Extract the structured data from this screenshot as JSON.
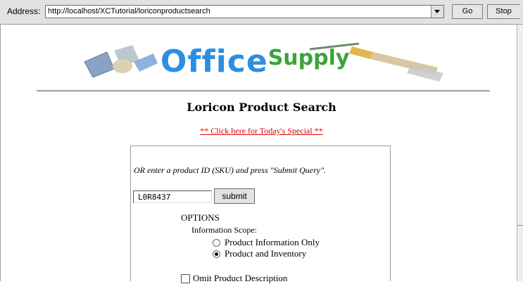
{
  "browser": {
    "address_label": "Address:",
    "url": "http://localhost/XCTutorial/loriconproductsearch",
    "go_label": "Go",
    "stop_label": "Stop"
  },
  "logo": {
    "office": "Office",
    "supply": "Supply"
  },
  "page": {
    "title": "Loricon Product Search",
    "special_link": "** Click here for Today's Special **"
  },
  "search": {
    "instructions": "OR enter a product ID (SKU) and press \"Submit Query\".",
    "sku_value": "L0R8437",
    "submit_label": "submit"
  },
  "options": {
    "heading": "OPTIONS",
    "scope_label": "Information Scope:",
    "radios": [
      {
        "label": "Product Information Only",
        "selected": false
      },
      {
        "label": "Product and Inventory",
        "selected": true
      }
    ],
    "omit_description_label": "Omit Product Description",
    "omit_description_checked": false
  },
  "colors": {
    "logo_office": "#2d8ee0",
    "logo_supply": "#3aa33a",
    "special_link": "#e00000"
  }
}
